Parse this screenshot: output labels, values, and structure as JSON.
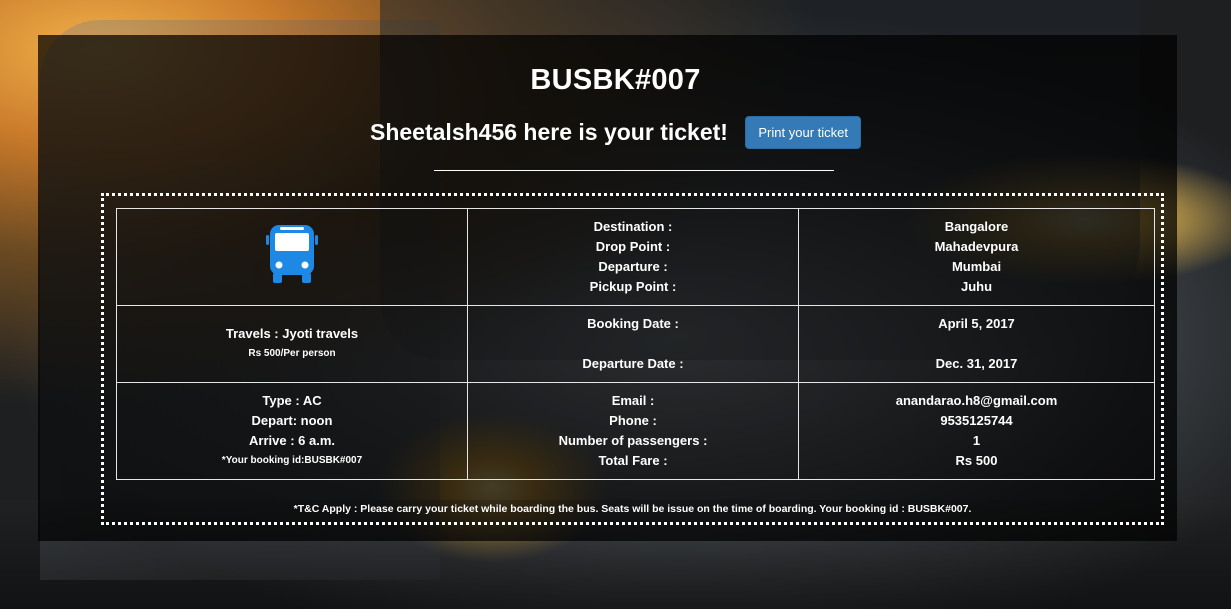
{
  "booking_code": "BUSBK#007",
  "greeting": "Sheetalsh456 here is your ticket!",
  "print_button_label": "Print your ticket",
  "icons": {
    "bus": "bus-icon"
  },
  "colors": {
    "accent": "#337ab7",
    "bus_icon": "#1e88e5"
  },
  "ticket": {
    "row1": {
      "labels": [
        "Destination :",
        "Drop Point :",
        "Departure :",
        "Pickup Point :"
      ],
      "values": [
        "Bangalore",
        "Mahadevpura",
        "Mumbai",
        "Juhu"
      ]
    },
    "row2": {
      "travels": "Travels : Jyoti travels",
      "fare_per_person": "Rs 500/Per person",
      "booking_date_label": "Booking Date :",
      "departure_date_label": "Departure Date :",
      "booking_date": "April 5, 2017",
      "departure_date": "Dec. 31, 2017"
    },
    "row3": {
      "type": "Type : AC",
      "depart": "Depart: noon",
      "arrive": "Arrive : 6 a.m.",
      "booking_id_note": "*Your booking id:BUSBK#007",
      "labels": [
        "Email :",
        "Phone :",
        "Number of passengers :",
        "Total Fare :"
      ],
      "values": [
        "anandarao.h8@gmail.com",
        "9535125744",
        "1",
        "Rs 500"
      ]
    },
    "footer": "*T&C Apply : Please carry your ticket while boarding the bus. Seats will be issue on the time of boarding. Your booking id : BUSBK#007."
  }
}
